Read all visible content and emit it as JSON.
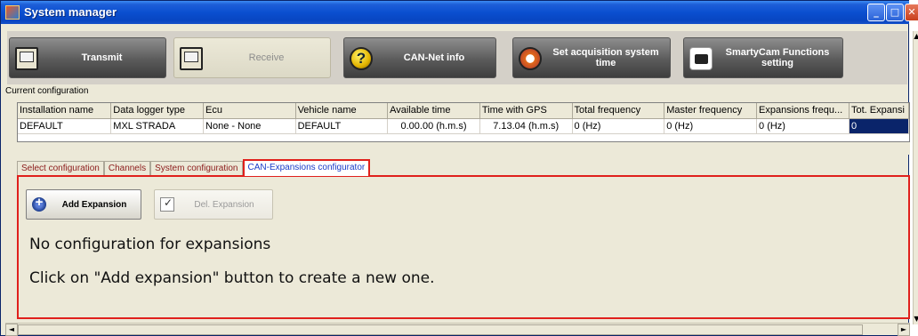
{
  "window": {
    "title": "System manager"
  },
  "toolbar": {
    "transmit": "Transmit",
    "receive": "Receive",
    "can_net_info": "CAN-Net info",
    "set_acq_time": "Set acquisition system time",
    "smartycam": "SmartyCam Functions setting"
  },
  "config": {
    "label": "Current configuration",
    "columns": [
      "Installation name",
      "Data logger type",
      "Ecu",
      "Vehicle name",
      "Available time",
      "Time with GPS",
      "Total frequency",
      "Master frequency",
      "Expansions frequ...",
      "Tot. Expansi"
    ],
    "row": [
      "DEFAULT",
      "MXL STRADA",
      "None - None",
      "DEFAULT",
      "0.00.00 (h.m.s)",
      "7.13.04 (h.m.s)",
      "0 (Hz)",
      "0 (Hz)",
      "0 (Hz)",
      "0"
    ]
  },
  "tabs": [
    "Select configuration",
    "Channels",
    "System configuration",
    "CAN-Expansions configurator"
  ],
  "active_tab": "CAN-Expansions configurator",
  "panel": {
    "add_button": "Add Expansion",
    "del_button": "Del. Expansion",
    "message_title": "No configuration for expansions",
    "message_hint": "Click on \"Add expansion\" button to create a new one."
  },
  "colors": {
    "titlebar": "#0a4fd0",
    "highlight_border": "#e0201c",
    "selected_cell": "#0a246a"
  }
}
